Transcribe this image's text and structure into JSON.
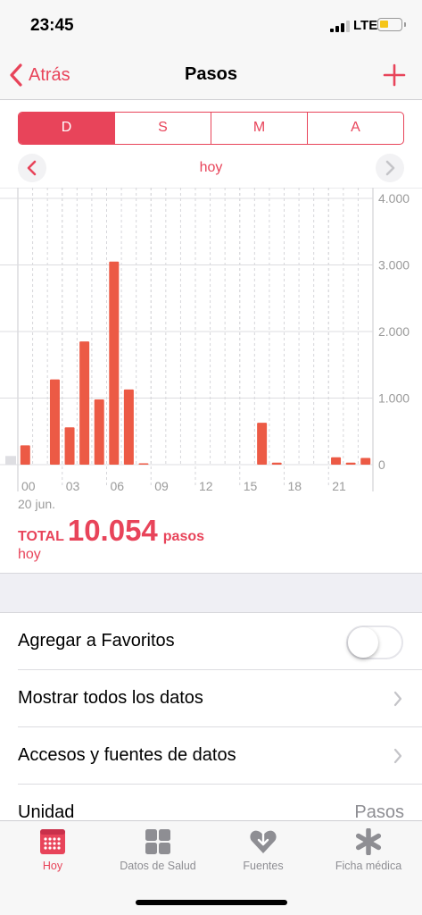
{
  "status": {
    "time": "23:45",
    "network": "LTE",
    "battery_level": 0.45
  },
  "nav": {
    "back_label": "Atrás",
    "title": "Pasos",
    "add_icon": "plus-icon"
  },
  "segments": [
    {
      "label": "D",
      "active": true
    },
    {
      "label": "S",
      "active": false
    },
    {
      "label": "M",
      "active": false
    },
    {
      "label": "A",
      "active": false
    }
  ],
  "period": {
    "label": "hoy"
  },
  "chart_data": {
    "type": "bar",
    "x_unit": "hour",
    "categories": [
      "00",
      "01",
      "02",
      "03",
      "04",
      "05",
      "06",
      "07",
      "08",
      "09",
      "10",
      "11",
      "12",
      "13",
      "14",
      "15",
      "16",
      "17",
      "18",
      "19",
      "20",
      "21",
      "22",
      "23"
    ],
    "values": [
      290,
      0,
      1280,
      560,
      1850,
      980,
      3050,
      1130,
      10,
      0,
      0,
      0,
      0,
      0,
      0,
      0,
      630,
      30,
      0,
      0,
      0,
      110,
      30,
      100
    ],
    "previous_day_last_value": 130,
    "x_tick_labels": [
      "00",
      "03",
      "06",
      "09",
      "12",
      "15",
      "18",
      "21"
    ],
    "y_tick_labels": [
      "4.000",
      "3.000",
      "2.000",
      "1.000",
      "0"
    ],
    "y_ticks": [
      4000,
      3000,
      2000,
      1000,
      0
    ],
    "ylim": [
      0,
      4000
    ],
    "bar_color": "#ec5a45",
    "grid": true
  },
  "summary": {
    "date": "20 jun.",
    "total_label": "TOTAL",
    "total_value": "10.054",
    "unit": "pasos",
    "period": "hoy"
  },
  "rows": {
    "favorites": {
      "label": "Agregar a Favoritos",
      "toggle_on": false
    },
    "show_all": {
      "label": "Mostrar todos los datos"
    },
    "sources": {
      "label": "Accesos y fuentes de datos"
    },
    "unit": {
      "label": "Unidad",
      "value": "Pasos"
    }
  },
  "tabs": [
    {
      "label": "Hoy",
      "icon": "calendar-icon",
      "active": true
    },
    {
      "label": "Datos de Salud",
      "icon": "grid-icon",
      "active": false
    },
    {
      "label": "Fuentes",
      "icon": "heart-download-icon",
      "active": false
    },
    {
      "label": "Ficha médica",
      "icon": "asterisk-icon",
      "active": false
    }
  ],
  "colors": {
    "accent": "#e8445a",
    "bar": "#ec5a45",
    "inactive": "#8e8e93"
  }
}
